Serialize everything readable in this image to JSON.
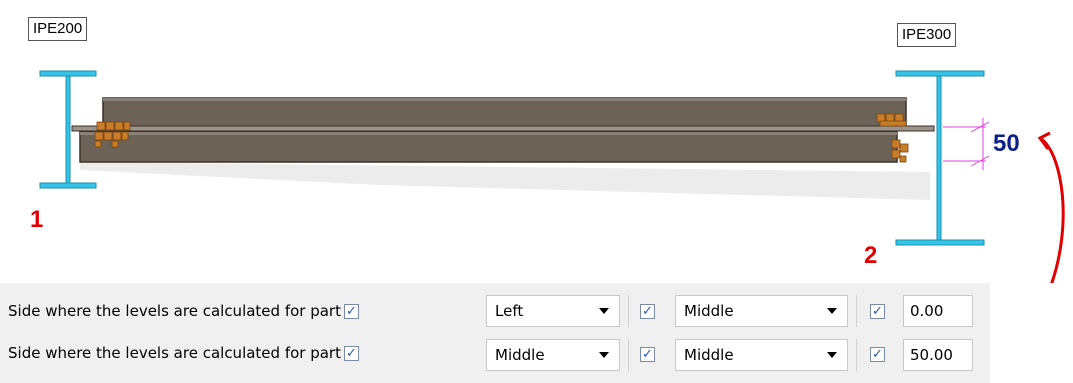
{
  "diagram": {
    "left_profile": "IPE200",
    "right_profile": "IPE300",
    "left_number": "1",
    "right_number": "2",
    "offset_value": "50",
    "colors": {
      "profile": "#33c4e8",
      "beam": "#6b6258",
      "bolts": "#c87d28",
      "marker": "#e00000",
      "dimension": "#e040e0",
      "offset_text": "#0a1f8a"
    }
  },
  "rows": [
    {
      "label": "Side where the levels are calculated for part",
      "checkbox1": true,
      "combo1": "Left",
      "checkbox2": true,
      "combo2": "Middle",
      "checkbox3": true,
      "value": "0.00"
    },
    {
      "label": "Side where the levels are calculated for part",
      "checkbox1": true,
      "combo1": "Middle",
      "checkbox2": true,
      "combo2": "Middle",
      "checkbox3": true,
      "value": "50.00"
    }
  ]
}
